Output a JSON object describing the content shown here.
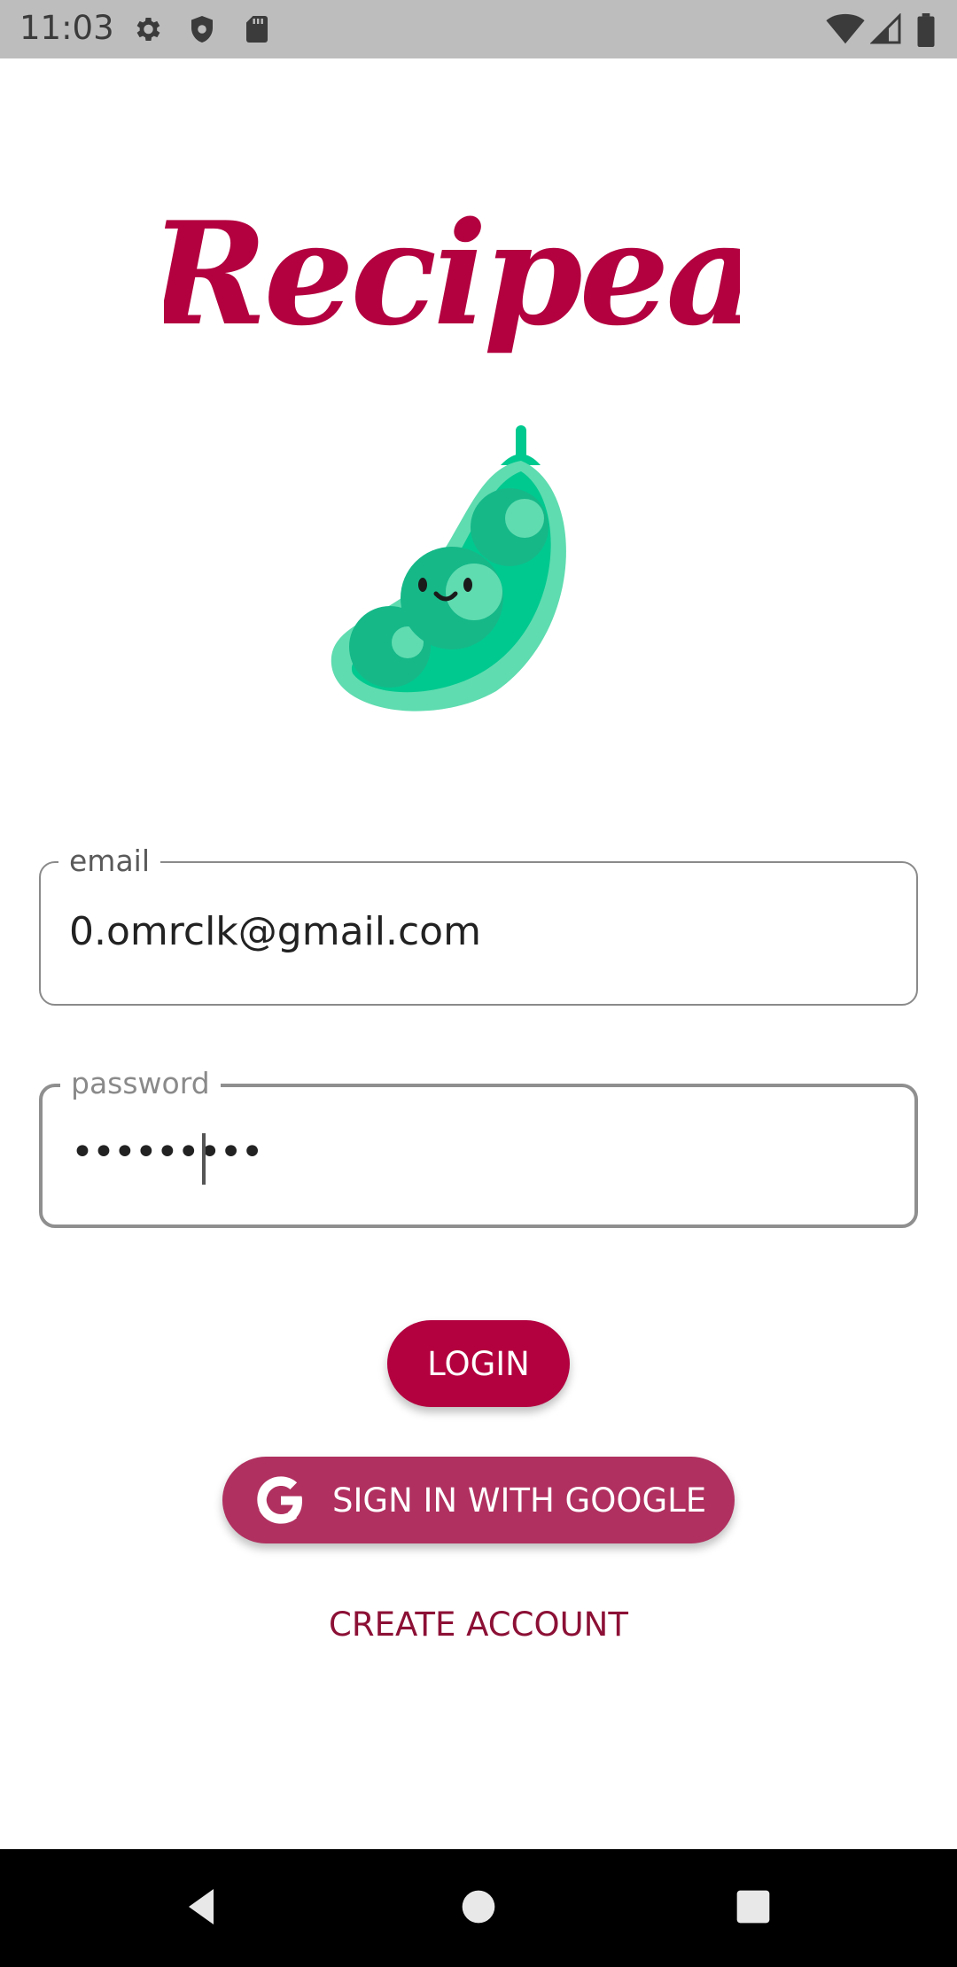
{
  "status_bar": {
    "time": "11:03",
    "icons_left": [
      "gear-icon",
      "shield-icon",
      "sd-card-icon"
    ],
    "icons_right": [
      "wifi-icon",
      "signal-icon",
      "battery-icon"
    ]
  },
  "logo": {
    "wordmark": "Recipea",
    "mascot": "pea-pod-icon",
    "brand_color": "#b3003f",
    "mascot_color": "#00c98f"
  },
  "form": {
    "email": {
      "label": "email",
      "value": "0.omrclk@gmail.com"
    },
    "password": {
      "label": "password",
      "masked_value": "•••••••••"
    }
  },
  "buttons": {
    "login_label": "LOGIN",
    "google_label": "SIGN IN WITH GOOGLE",
    "create_account_label": "CREATE ACCOUNT"
  },
  "nav_bar": {
    "icons": [
      "back-icon",
      "home-icon",
      "recents-icon"
    ]
  }
}
